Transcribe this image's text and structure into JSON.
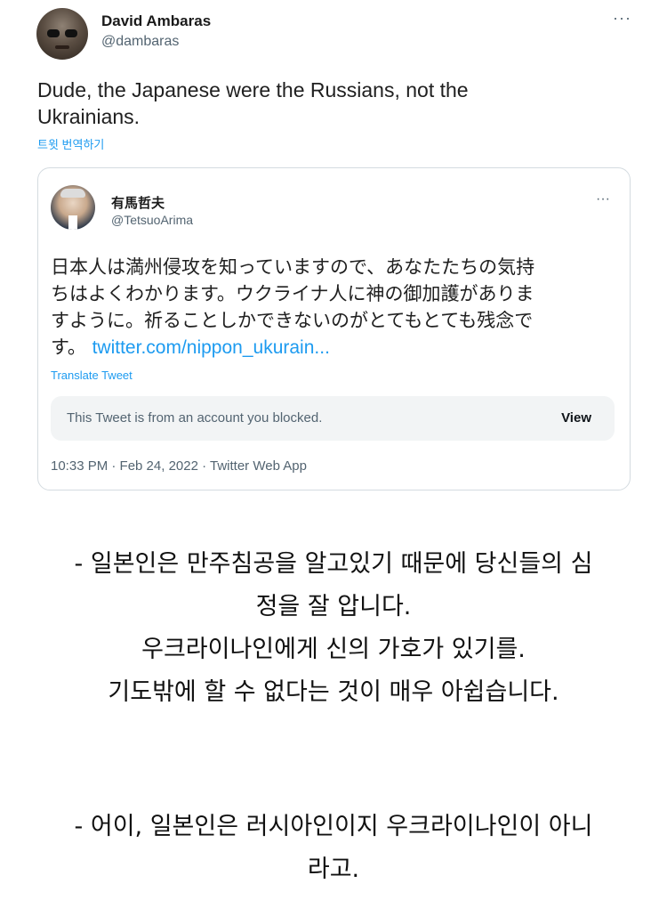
{
  "tweet": {
    "author_name": "David Ambaras",
    "author_handle": "@dambaras",
    "more_icon": "···",
    "text_line1": "Dude, the Japanese were the Russians, not the",
    "text_line2": "Ukrainians.",
    "translate_label": "트윗 번역하기"
  },
  "quoted_tweet": {
    "author_name": "有馬哲夫",
    "author_handle": "@TetsuoArima",
    "more_icon": "···",
    "text_line1": "日本人は満州侵攻を知っていますので、あなたたちの気持",
    "text_line2": "ちはよくわかります。ウクライナ人に神の御加護がありま",
    "text_line3": "すように。祈ることしかできないのがとてもとても残念で",
    "text_line4_prefix": "す。",
    "link_text": "twitter.com/nippon_ukurain...",
    "translate_label": "Translate Tweet",
    "blocked_message": "This Tweet is from an account you blocked.",
    "view_label": "View",
    "timestamp": "10:33 PM · Feb 24, 2022 · Twitter Web App"
  },
  "captions": {
    "first": [
      "- 일본인은 만주침공을 알고있기 때문에 당신들의 심",
      "정을 잘 압니다.",
      "우크라이나인에게 신의 가호가 있기를.",
      "기도밖에 할 수 없다는 것이 매우 아쉽습니다."
    ],
    "second": [
      "- 어이, 일본인은 러시아인이지 우크라이나인이 아니",
      "라고."
    ]
  },
  "colors": {
    "link_blue": "#1d9bf0",
    "muted_gray": "#536471",
    "border": "#d4dbe0"
  }
}
